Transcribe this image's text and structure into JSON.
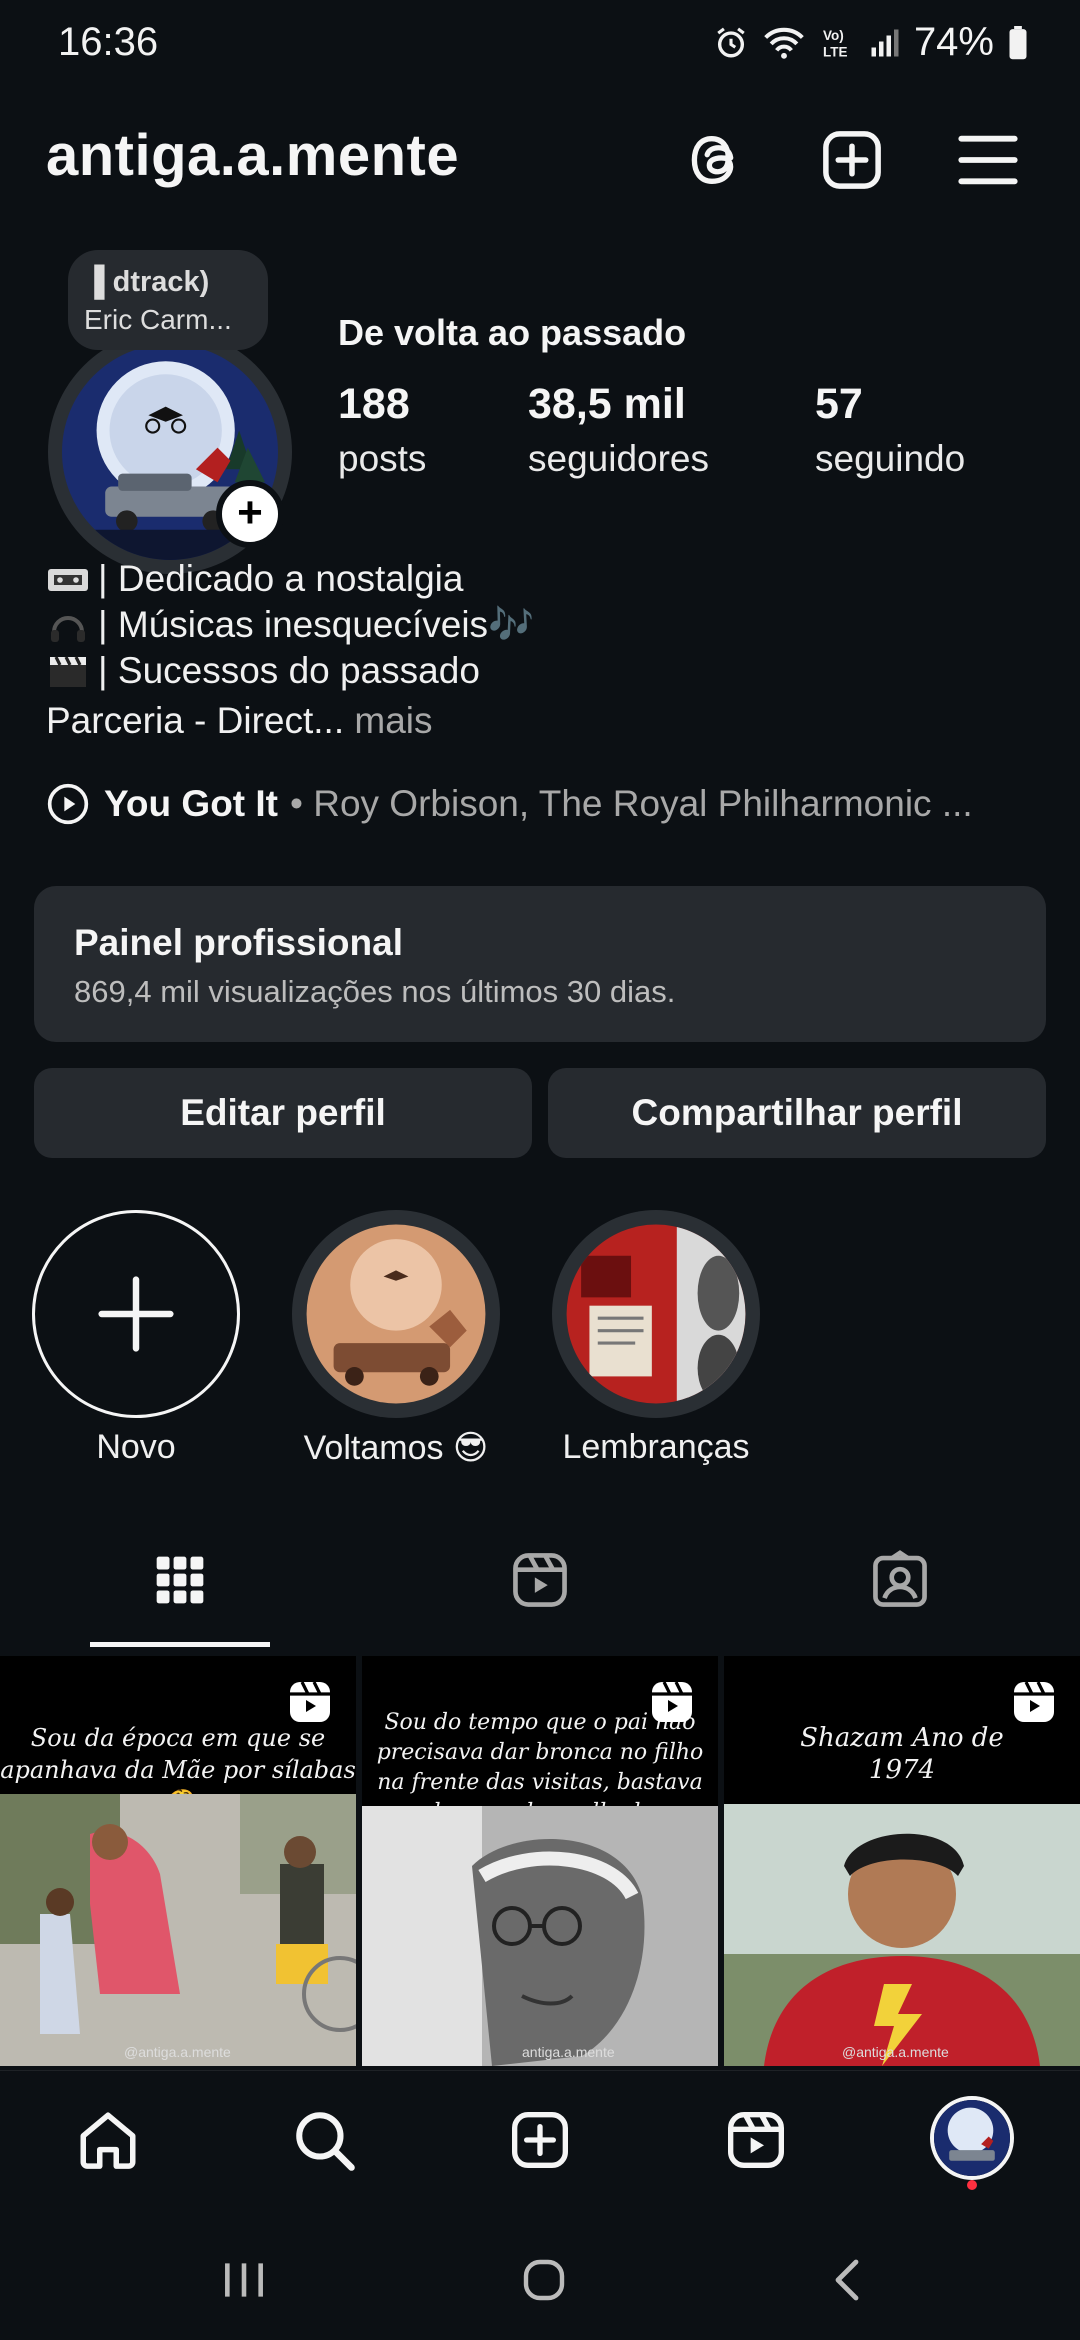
{
  "status_bar": {
    "time": "16:36",
    "battery": "74%",
    "network": "Vo) LTE"
  },
  "header": {
    "username": "antiga.a.mente"
  },
  "profile": {
    "note_line1": "▐ dtrack)",
    "note_line2": "Eric Carm...",
    "display_name": "De volta ao passado",
    "stats": [
      {
        "value": "188",
        "label": "posts"
      },
      {
        "value": "38,5 mil",
        "label": "seguidores"
      },
      {
        "value": "57",
        "label": "seguindo"
      }
    ],
    "bio": [
      "| Dedicado a nostalgia",
      "| Músicas inesquecíveis🎶",
      "| Sucessos do passado",
      "Parceria - Direct..."
    ],
    "bio_more": "mais",
    "music": {
      "song": "You Got It",
      "artist": "• Roy Orbison, The Royal Philharmonic ..."
    }
  },
  "panel": {
    "title": "Painel profissional",
    "subtitle": "869,4 mil visualizações nos últimos 30 dias."
  },
  "buttons": {
    "edit": "Editar perfil",
    "share": "Compartilhar perfil"
  },
  "highlights": [
    {
      "label": "Novo"
    },
    {
      "label": "Voltamos 😎"
    },
    {
      "label": "Lembranças"
    }
  ],
  "posts": [
    {
      "caption": "Sou da época em que se apanhava da Mãe por sílabas 🤔",
      "watermark": "@antiga.a.mente"
    },
    {
      "caption": "Sou do tempo que o pai não precisava dar bronca no filho na frente das visitas, bastava dar uma leve olhada",
      "watermark": "antiga.a.mente"
    },
    {
      "caption": "Shazam Ano de 1974",
      "watermark": "@antiga.a.mente"
    }
  ],
  "colors": {
    "background": "#0c1014",
    "surface": "#262a2f",
    "secondary_text": "#a8a8a8",
    "notification_dot": "#ff3040"
  }
}
